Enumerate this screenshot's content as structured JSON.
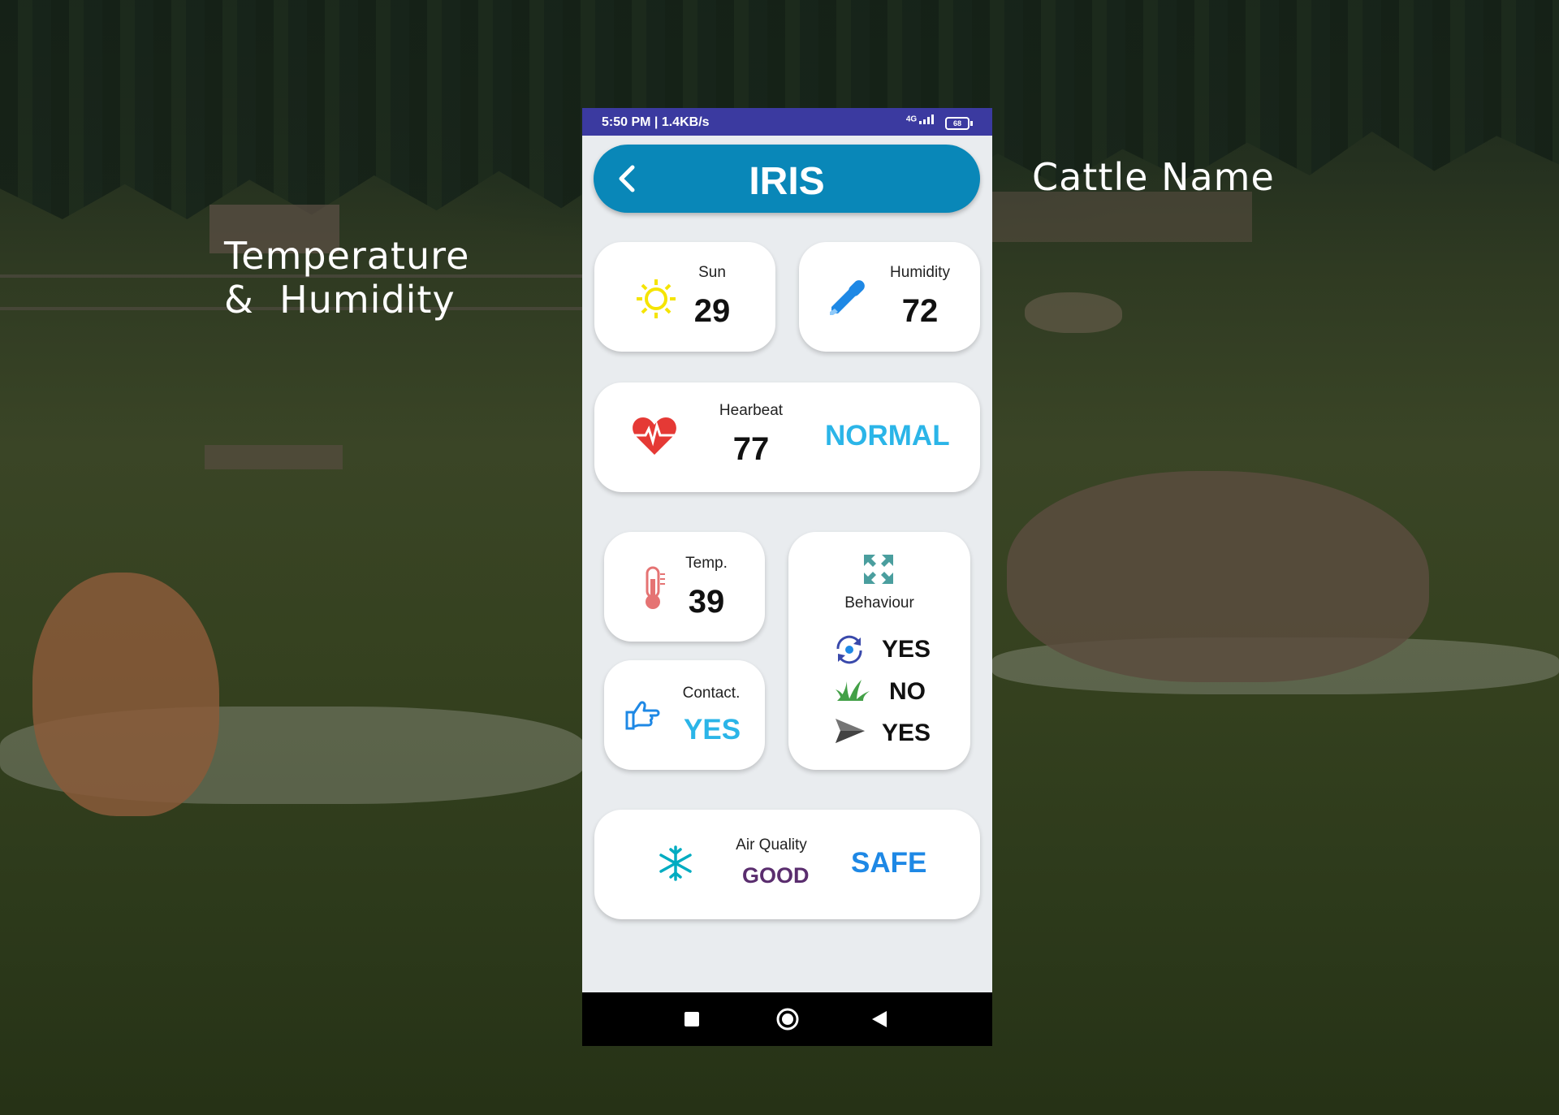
{
  "overlay": {
    "left_label": "Temperature\n&  Humidity",
    "right_label": "Cattle Name"
  },
  "statusbar": {
    "time": "5:50 PM | 1.4KB/s",
    "network": "4G",
    "battery": "68"
  },
  "header": {
    "title": "IRIS",
    "back_icon": "chevron-left-icon"
  },
  "sun_card": {
    "label": "Sun",
    "value": "29",
    "icon": "sun-icon"
  },
  "humidity_card": {
    "label": "Humidity",
    "value": "72",
    "icon": "dropper-icon"
  },
  "heartbeat_card": {
    "label": "Hearbeat",
    "value": "77",
    "status": "NORMAL",
    "icon": "heart-pulse-icon"
  },
  "temp_card": {
    "label": "Temp.",
    "value": "39",
    "icon": "thermometer-icon"
  },
  "contact_card": {
    "label": "Contact.",
    "status": "YES",
    "icon": "thumbs-pointing-icon"
  },
  "behaviour_card": {
    "label": "Behaviour",
    "icon": "expand-arrows-icon",
    "rows": [
      {
        "icon": "rotate-icon",
        "value": "YES"
      },
      {
        "icon": "grass-icon",
        "value": "NO"
      },
      {
        "icon": "send-arrow-icon",
        "value": "YES"
      }
    ]
  },
  "air_card": {
    "label": "Air Quality",
    "quality": "GOOD",
    "status": "SAFE",
    "icon": "snowflake-icon"
  },
  "colors": {
    "header": "#0987b8",
    "statusbar": "#3b3aa0",
    "normal": "#2bb5e8",
    "contact_yes": "#2bb5e8",
    "safe": "#1e88e5",
    "good": "#5a2d6e",
    "sun": "#f5e400",
    "heart": "#e53935"
  }
}
